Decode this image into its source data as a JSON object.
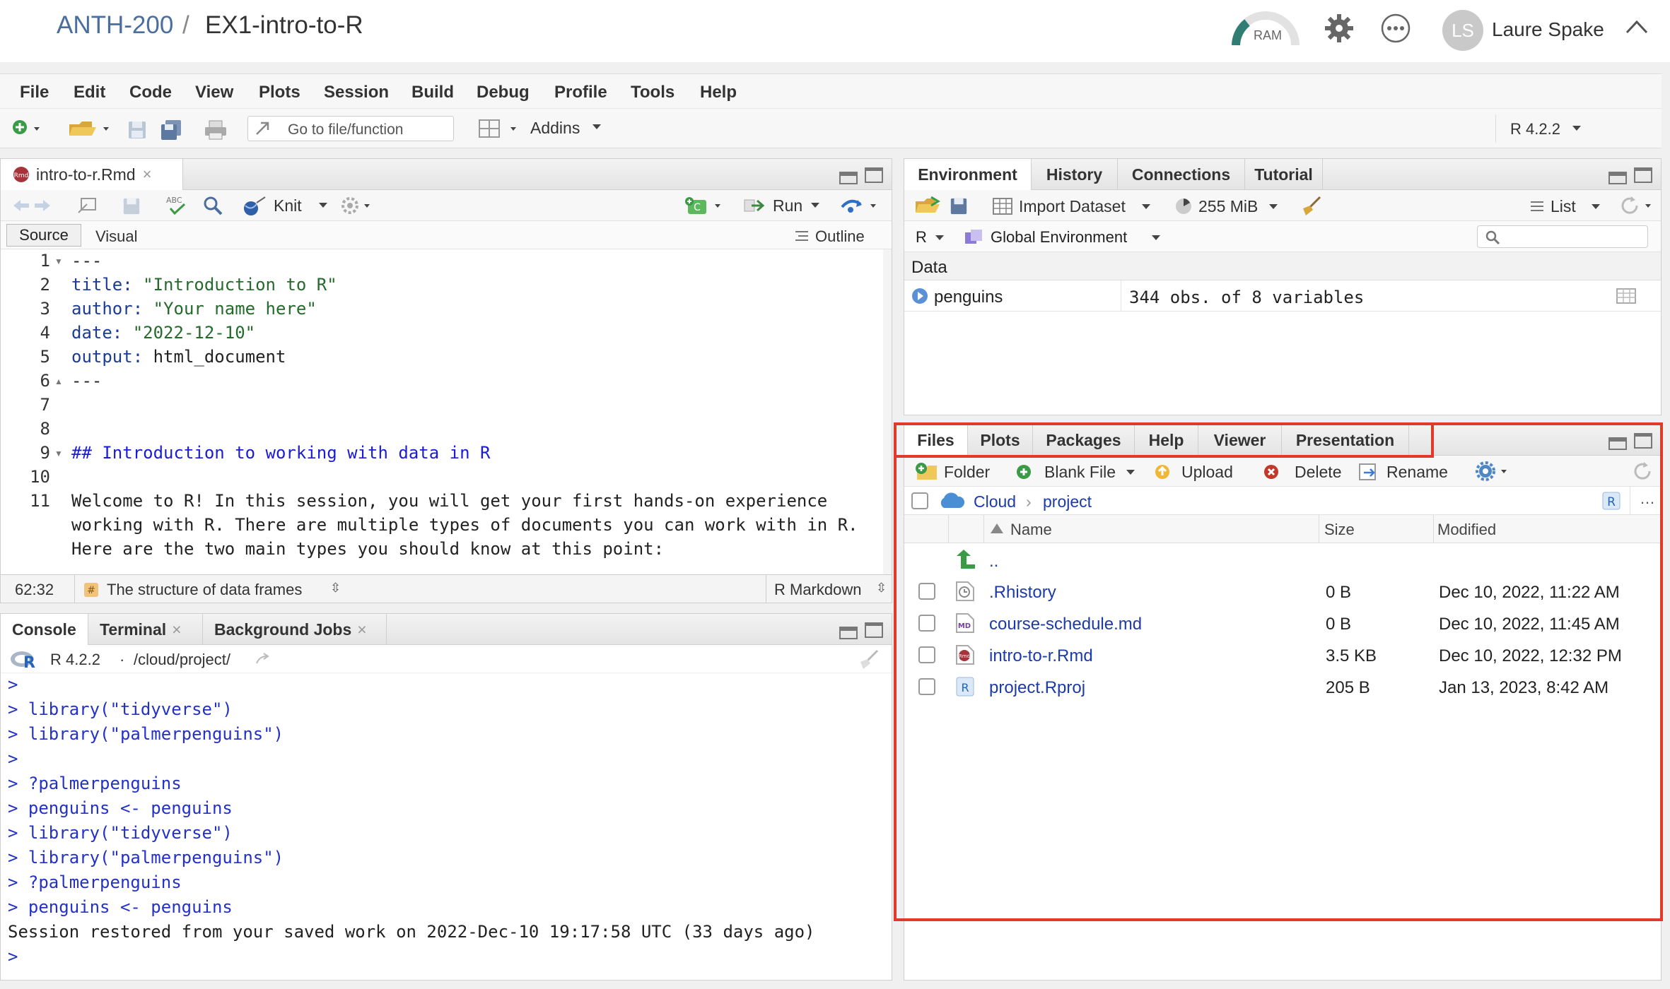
{
  "header": {
    "course": "ANTH-200",
    "separator": "/",
    "project_name": "EX1-intro-to-R",
    "ram_label": "RAM",
    "user_initials": "LS",
    "user_name": "Laure Spake"
  },
  "menu": [
    "File",
    "Edit",
    "Code",
    "View",
    "Plots",
    "Session",
    "Build",
    "Debug",
    "Profile",
    "Tools",
    "Help"
  ],
  "toolbar": {
    "goto_placeholder": "Go to file/function",
    "addins": "Addins",
    "r_version": "R 4.2.2"
  },
  "editor": {
    "tab_name": "intro-to-r.Rmd",
    "knit": "Knit",
    "run": "Run",
    "mode_source": "Source",
    "mode_visual": "Visual",
    "outline": "Outline",
    "lines": [
      {
        "n": "1",
        "segs": [
          {
            "c": "",
            "t": "---"
          }
        ]
      },
      {
        "n": "2",
        "segs": [
          {
            "c": "kw",
            "t": "title:"
          },
          {
            "c": "str",
            "t": " \"Introduction to R\""
          }
        ]
      },
      {
        "n": "3",
        "segs": [
          {
            "c": "kw",
            "t": "author:"
          },
          {
            "c": "str",
            "t": " \"Your name here\""
          }
        ]
      },
      {
        "n": "4",
        "segs": [
          {
            "c": "kw",
            "t": "date:"
          },
          {
            "c": "str",
            "t": " \"2022-12-10\""
          }
        ]
      },
      {
        "n": "5",
        "segs": [
          {
            "c": "kw",
            "t": "output:"
          },
          {
            "c": "",
            "t": " html_document"
          }
        ]
      },
      {
        "n": "6",
        "segs": [
          {
            "c": "",
            "t": "---"
          }
        ]
      },
      {
        "n": "7",
        "segs": []
      },
      {
        "n": "8",
        "segs": []
      },
      {
        "n": "9",
        "segs": [
          {
            "c": "hd",
            "t": "## Introduction to working with data in R"
          }
        ]
      },
      {
        "n": "10",
        "segs": []
      },
      {
        "n": "11",
        "segs": [
          {
            "c": "",
            "t": "Welcome to R! In this session, you will get your first hands-on experience"
          }
        ]
      },
      {
        "n": "",
        "segs": [
          {
            "c": "",
            "t": "working with R. There are multiple types of documents you can work with in R."
          }
        ]
      },
      {
        "n": "",
        "segs": [
          {
            "c": "",
            "t": "Here are the two main types you should know at this point:"
          }
        ]
      }
    ],
    "status_pos": "62:32",
    "status_section": "The structure of data frames",
    "status_type": "R Markdown"
  },
  "console": {
    "tabs": [
      "Console",
      "Terminal",
      "Background Jobs"
    ],
    "r_version": "R 4.2.2",
    "path": "/cloud/project/",
    "lines": [
      ">",
      "> library(\"tidyverse\")",
      "> library(\"palmerpenguins\")",
      ">",
      "> ?palmerpenguins",
      "> penguins <- penguins",
      "> library(\"tidyverse\")",
      "> library(\"palmerpenguins\")",
      "> ?palmerpenguins",
      "> penguins <- penguins"
    ],
    "session_msg": "Session restored from your saved work on 2022-Dec-10 19:17:58 UTC (33 days ago)",
    "prompt": ">"
  },
  "environment": {
    "tabs": [
      "Environment",
      "History",
      "Connections",
      "Tutorial"
    ],
    "import_dataset": "Import Dataset",
    "memory": "255 MiB",
    "list": "List",
    "r_label": "R",
    "global_env": "Global Environment",
    "section": "Data",
    "rows": [
      {
        "name": "penguins",
        "value": "344 obs. of 8 variables"
      }
    ]
  },
  "files": {
    "tabs": [
      "Files",
      "Plots",
      "Packages",
      "Help",
      "Viewer",
      "Presentation"
    ],
    "folder": "Folder",
    "blank_file": "Blank File",
    "upload": "Upload",
    "delete": "Delete",
    "rename": "Rename",
    "breadcrumb_root": "Cloud",
    "breadcrumb_dir": "project",
    "col_name": "Name",
    "col_size": "Size",
    "col_modified": "Modified",
    "parent": "..",
    "rows": [
      {
        "name": ".Rhistory",
        "size": "0 B",
        "modified": "Dec 10, 2022, 11:22 AM",
        "icon": "history-file-icon"
      },
      {
        "name": "course-schedule.md",
        "size": "0 B",
        "modified": "Dec 10, 2022, 11:45 AM",
        "icon": "markdown-file-icon"
      },
      {
        "name": "intro-to-r.Rmd",
        "size": "3.5 KB",
        "modified": "Dec 10, 2022, 12:32 PM",
        "icon": "rmd-file-icon"
      },
      {
        "name": "project.Rproj",
        "size": "205 B",
        "modified": "Jan 13, 2023, 8:42 AM",
        "icon": "rproj-file-icon"
      }
    ]
  },
  "colors": {
    "highlight_box": "#e03a2a",
    "link": "#1c3aa8",
    "console_text": "#2331c8"
  }
}
